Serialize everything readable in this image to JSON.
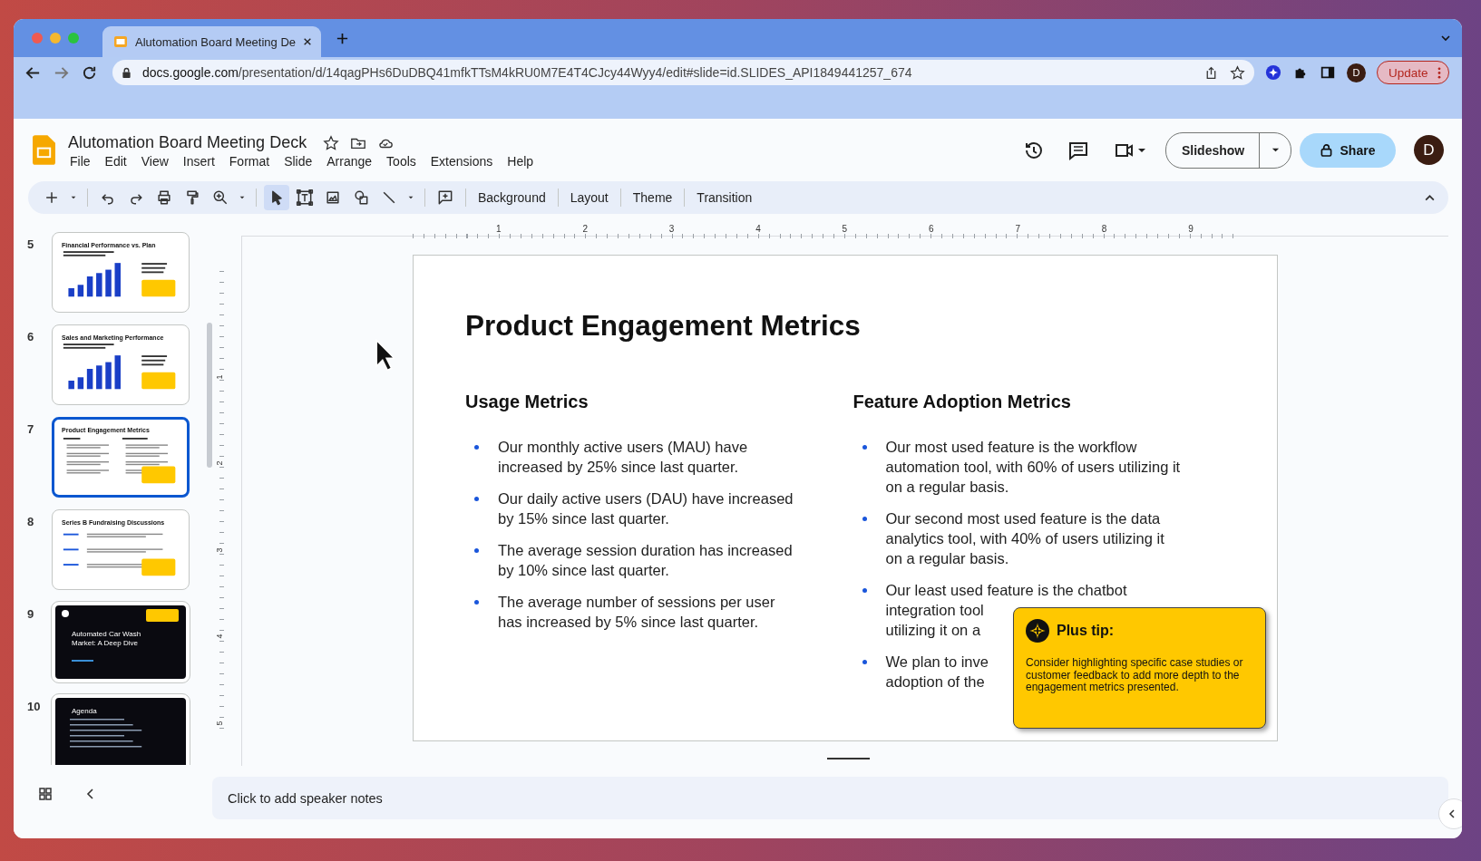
{
  "browser": {
    "tab_title": "Alutomation Board Meeting De",
    "url_host": "docs.google.com",
    "url_path": "/presentation/d/14qagPHs6DuDBQ41mfkTTsM4kRU0M7E4T4CJcy44Wyy4/edit#slide=id.SLIDES_API1849441257_674",
    "profile": "D",
    "update_button": "Update"
  },
  "app": {
    "doc_title": "Alutomation Board Meeting Deck",
    "menus": [
      "File",
      "Edit",
      "View",
      "Insert",
      "Format",
      "Slide",
      "Arrange",
      "Tools",
      "Extensions",
      "Help"
    ],
    "slideshow_button": "Slideshow",
    "share_button": "Share",
    "avatar": "D"
  },
  "toolbar": {
    "tools": [
      {
        "kind": "add",
        "selected": false
      },
      {
        "kind": "caret",
        "selected": false
      },
      {
        "kind": "undo",
        "selected": false
      },
      {
        "kind": "redo",
        "selected": false
      },
      {
        "kind": "print",
        "selected": false
      },
      {
        "kind": "paint",
        "selected": false
      },
      {
        "kind": "zoom",
        "selected": false
      },
      {
        "kind": "caret",
        "selected": false
      },
      {
        "kind": "select",
        "selected": true
      },
      {
        "kind": "textbox",
        "selected": false
      },
      {
        "kind": "image",
        "selected": false
      },
      {
        "kind": "shape",
        "selected": false
      },
      {
        "kind": "line",
        "selected": false
      },
      {
        "kind": "caret",
        "selected": false
      },
      {
        "kind": "comment",
        "selected": false
      }
    ],
    "buttons": [
      "Background",
      "Layout",
      "Theme",
      "Transition"
    ]
  },
  "slides": [
    {
      "number": "5",
      "title": "Financial Performance vs. Plan",
      "kind": "chart",
      "selected": false
    },
    {
      "number": "6",
      "title": "Sales and Marketing Performance",
      "kind": "chart",
      "selected": false
    },
    {
      "number": "7",
      "title": "Product Engagement Metrics",
      "kind": "columns",
      "selected": true
    },
    {
      "number": "8",
      "title": "Series B Fundraising Discussions",
      "kind": "rows",
      "selected": false
    },
    {
      "number": "9",
      "title": "Automated Car Wash Market: A Deep Dive",
      "kind": "dark-title",
      "selected": false
    },
    {
      "number": "10",
      "title": "Agenda",
      "kind": "dark-list",
      "selected": false
    }
  ],
  "ruler": {
    "horizontal": [
      "1",
      "2",
      "3",
      "4",
      "5",
      "6",
      "7",
      "8",
      "9"
    ],
    "vertical": [
      "1",
      "2",
      "3",
      "4",
      "5"
    ]
  },
  "slide": {
    "title": "Product Engagement Metrics",
    "columns": [
      {
        "heading": "Usage Metrics",
        "bullets": [
          {
            "lines": [
              "Our monthly active users (MAU) have",
              "increased by 25% since last quarter."
            ]
          },
          {
            "lines": [
              "Our daily active users (DAU) have increased",
              "by 15% since last quarter."
            ]
          },
          {
            "lines": [
              "The average session duration has increased",
              "by 10% since last quarter."
            ]
          },
          {
            "lines": [
              "The average number of sessions per user",
              "has increased by 5% since last quarter."
            ]
          }
        ]
      },
      {
        "heading": "Feature Adoption Metrics",
        "bullets": [
          {
            "lines": [
              "Our most used feature is the workflow",
              "automation tool, with 60% of users utilizing it",
              "on a regular basis."
            ]
          },
          {
            "lines": [
              "Our second most used feature is the data",
              "analytics tool, with 40% of users utilizing it",
              "on a regular basis."
            ]
          },
          {
            "lines": [
              "Our least used feature is the chatbot",
              "integration tool",
              "utilizing it on a"
            ]
          },
          {
            "lines": [
              "We plan to inve",
              "adoption of the"
            ]
          }
        ]
      }
    ],
    "tip": {
      "title": "Plus tip:",
      "body": "Consider highlighting specific case studies or customer feedback to add more depth to the engagement metrics presented."
    }
  },
  "notes": {
    "placeholder": "Click to add speaker notes"
  }
}
